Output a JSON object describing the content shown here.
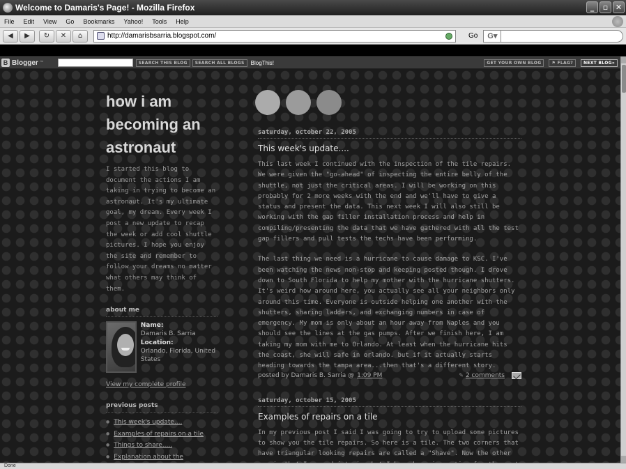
{
  "window": {
    "title": "Welcome to Damaris's Page! - Mozilla Firefox",
    "minimize": "_",
    "maximize": "▫",
    "close": "✕"
  },
  "menu": [
    "File",
    "Edit",
    "View",
    "Go",
    "Bookmarks",
    "Yahoo!",
    "Tools",
    "Help"
  ],
  "nav": {
    "back": "◀",
    "forward": "▶",
    "reload": "↻",
    "stop": "✕",
    "home": "⌂",
    "url": "http://damarisbsarria.blogspot.com/",
    "go": "Go",
    "search_engine": "G▾"
  },
  "blogger_bar": {
    "logo": "Blogger",
    "logo_sup": "™",
    "search_this_blog": "SEARCH THIS BLOG",
    "search_all_blogs": "SEARCH ALL BLOGS",
    "blogthis": "BlogThis!",
    "get_your_own": "GET YOUR OWN BLOG",
    "flag": "⚑ FLAG?",
    "next_blog": "NEXT BLOG»"
  },
  "sidebar": {
    "title": "how i am becoming an astronaut",
    "description": "I started this blog to document the actions I am taking in trying to become an astronaut. It's my ultimate goal, my dream. Every week I post a new update to recap the week or add cool shuttle pictures. I hope you enjoy the site and remember to follow your dreams no matter what others may think of them.",
    "about_heading": "about me",
    "name_label": "Name:",
    "name_value": "Damaris B. Sarria",
    "location_label": "Location:",
    "location_value": "Orlando, Florida, United States",
    "profile_link": "View my complete profile",
    "previous_heading": "previous posts",
    "previous_posts": [
      "This week's update....",
      "Examples of repairs on a tile",
      "Things to share.....",
      "Explanation about the"
    ]
  },
  "posts": [
    {
      "date": "saturday, october 22, 2005",
      "title": "This week's update....",
      "paragraphs": [
        "This last week I continued with the inspection of the tile repairs. We were given the \"go-ahead\" of inspecting the entire belly of the shuttle, not just the critical areas. I will be working on this probably for 2 more weeks with the end and we'll have to give a status and present the data. This next week I will also still be working with the gap filler installation process and help in compiling/presenting the data that we have gathered with all the test gap fillers and pull tests the techs have been performing.",
        "The last thing we need is a hurricane to cause damage to KSC. I've been watching the news non-stop and keeping posted though. I drove down to South Florida to help my mother with the hurricane shutters. It's weird how around here, you actually see all your neighbors only around this time. Everyone is outside helping one another with the shutters, sharing ladders, and exchanging numbers in case of emergency. My mom is only about an hour away from Naples and you should see the lines at the gas pumps. After we finish here, I am taking my mom with me to Orlando. At least when the hurricane hits the coast, she will safe in orlando. but if it actually starts heading towards the tampa area...then that's a different story."
      ],
      "posted_by": "posted by Damaris B. Sarria @",
      "time": "1:09 PM",
      "comments": "2 comments"
    },
    {
      "date": "saturday, october 15, 2005",
      "title": "Examples of repairs on a tile",
      "paragraphs": [
        "In my previous post I said I was going to try to upload some pictures to show you the tile repairs. So here is a tile. The two corners that have triangular looking repairs are called a \"Shave\". Now the other repair that I zoomed into is what I have been inspecting for the past two weeks. We"
      ]
    }
  ],
  "status": {
    "text": "Done"
  }
}
